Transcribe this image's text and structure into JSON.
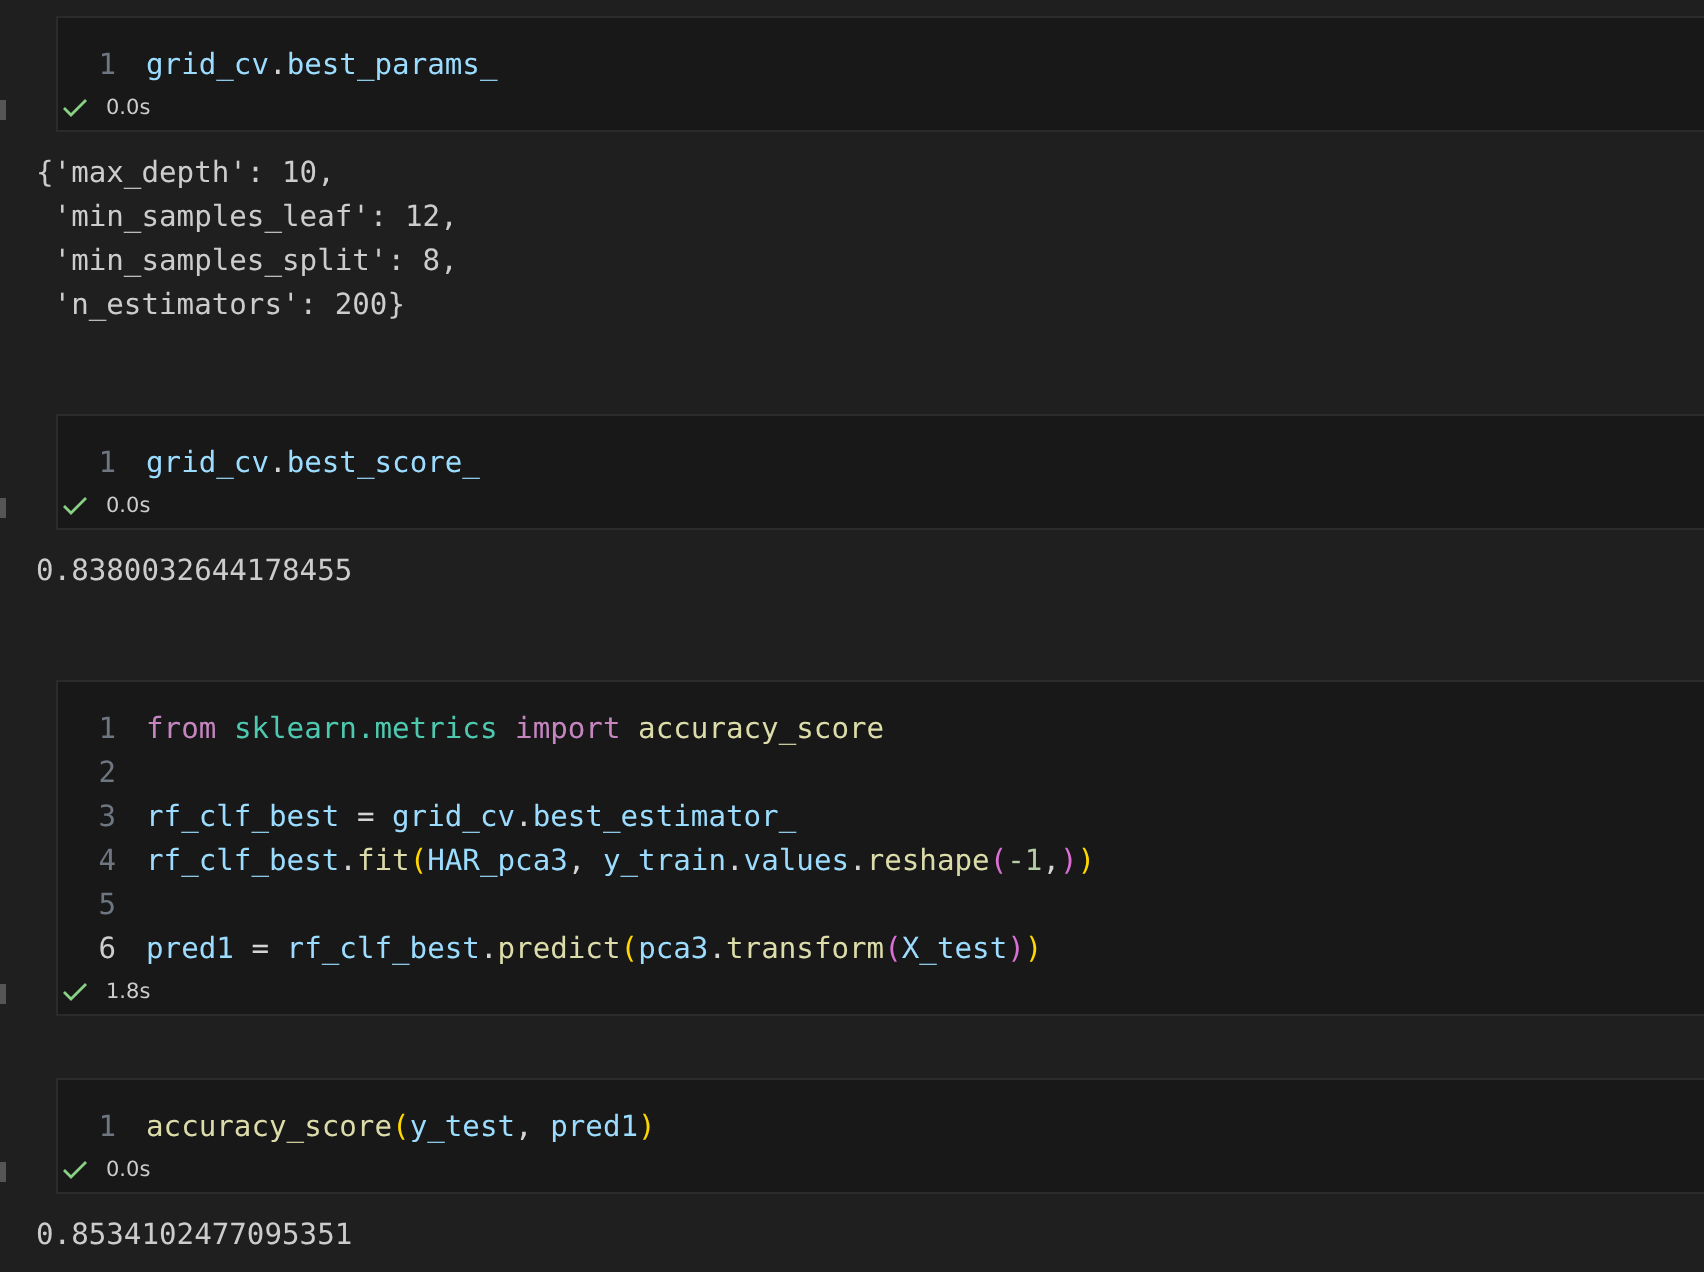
{
  "cells": [
    {
      "lines": [
        {
          "number": "1",
          "current": false,
          "tokens": [
            {
              "text": "grid_cv",
              "kind": "var"
            },
            {
              "text": ".",
              "kind": "plain"
            },
            {
              "text": "best_params_",
              "kind": "var"
            }
          ]
        }
      ],
      "status": {
        "ok": true,
        "time": "0.0s"
      },
      "output": [
        "{'max_depth': 10,",
        " 'min_samples_leaf': 12,",
        " 'min_samples_split': 8,",
        " 'n_estimators': 200}"
      ]
    },
    {
      "lines": [
        {
          "number": "1",
          "current": false,
          "tokens": [
            {
              "text": "grid_cv",
              "kind": "var"
            },
            {
              "text": ".",
              "kind": "plain"
            },
            {
              "text": "best_score_",
              "kind": "var"
            }
          ]
        }
      ],
      "status": {
        "ok": true,
        "time": "0.0s"
      },
      "output": [
        "0.8380032644178455"
      ]
    },
    {
      "lines": [
        {
          "number": "1",
          "current": false,
          "tokens": [
            {
              "text": "from ",
              "kind": "keyword"
            },
            {
              "text": "sklearn.metrics ",
              "kind": "module"
            },
            {
              "text": "import ",
              "kind": "keyword"
            },
            {
              "text": "accuracy_score",
              "kind": "func"
            }
          ]
        },
        {
          "number": "2",
          "current": false
        },
        {
          "number": "3",
          "current": false,
          "tokens": [
            {
              "text": "rf_clf_best",
              "kind": "var"
            },
            {
              "text": " = ",
              "kind": "plain"
            },
            {
              "text": "grid_cv",
              "kind": "var"
            },
            {
              "text": ".",
              "kind": "plain"
            },
            {
              "text": "best_estimator_",
              "kind": "var"
            }
          ]
        },
        {
          "number": "4",
          "current": false,
          "tokens": [
            {
              "text": "rf_clf_best",
              "kind": "var"
            },
            {
              "text": ".",
              "kind": "plain"
            },
            {
              "text": "fit",
              "kind": "func"
            },
            {
              "text": "(",
              "kind": "bracket1"
            },
            {
              "text": "HAR_pca3",
              "kind": "var"
            },
            {
              "text": ", ",
              "kind": "plain"
            },
            {
              "text": "y_train",
              "kind": "var"
            },
            {
              "text": ".",
              "kind": "plain"
            },
            {
              "text": "values",
              "kind": "var"
            },
            {
              "text": ".",
              "kind": "plain"
            },
            {
              "text": "reshape",
              "kind": "func"
            },
            {
              "text": "(",
              "kind": "bracket2"
            },
            {
              "text": "-1",
              "kind": "number"
            },
            {
              "text": ",",
              "kind": "plain"
            },
            {
              "text": ")",
              "kind": "bracket2"
            },
            {
              "text": ")",
              "kind": "bracket1"
            }
          ]
        },
        {
          "number": "5",
          "current": false
        },
        {
          "number": "6",
          "current": true,
          "tokens": [
            {
              "text": "pred1",
              "kind": "var"
            },
            {
              "text": " = ",
              "kind": "plain"
            },
            {
              "text": "rf_clf_best",
              "kind": "var"
            },
            {
              "text": ".",
              "kind": "plain"
            },
            {
              "text": "predict",
              "kind": "func"
            },
            {
              "text": "(",
              "kind": "bracket1"
            },
            {
              "text": "pca3",
              "kind": "var"
            },
            {
              "text": ".",
              "kind": "plain"
            },
            {
              "text": "transform",
              "kind": "func"
            },
            {
              "text": "(",
              "kind": "bracket2"
            },
            {
              "text": "X_test",
              "kind": "var"
            },
            {
              "text": ")",
              "kind": "bracket2"
            },
            {
              "text": ")",
              "kind": "bracket1"
            }
          ]
        }
      ],
      "status": {
        "ok": true,
        "time": "1.8s"
      }
    },
    {
      "lines": [
        {
          "number": "1",
          "current": false,
          "tokens": [
            {
              "text": "accuracy_score",
              "kind": "func"
            },
            {
              "text": "(",
              "kind": "bracket1"
            },
            {
              "text": "y_test",
              "kind": "var"
            },
            {
              "text": ", ",
              "kind": "plain"
            },
            {
              "text": "pred1",
              "kind": "var"
            },
            {
              "text": ")",
              "kind": "bracket1"
            }
          ]
        }
      ],
      "status": {
        "ok": true,
        "time": "0.0s"
      },
      "output": [
        "0.8534102477095351"
      ]
    }
  ]
}
